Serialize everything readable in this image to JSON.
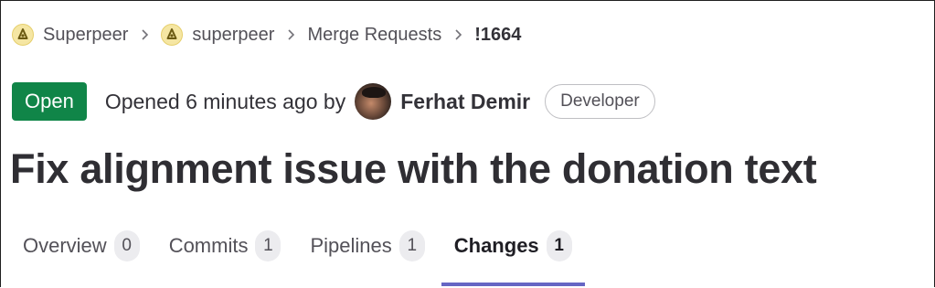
{
  "breadcrumb": {
    "items": [
      {
        "label": "Superpeer",
        "icon": "project-avatar-icon"
      },
      {
        "label": "superpeer",
        "icon": "project-avatar-icon"
      },
      {
        "label": "Merge Requests"
      },
      {
        "label": "!1664"
      }
    ]
  },
  "status": {
    "badge": "Open",
    "badge_color": "#108548",
    "opened_text": "Opened 6 minutes ago by",
    "author": "Ferhat Demir",
    "role": "Developer"
  },
  "title": "Fix alignment issue with the donation text",
  "tabs": [
    {
      "label": "Overview",
      "count": "0",
      "active": false
    },
    {
      "label": "Commits",
      "count": "1",
      "active": false
    },
    {
      "label": "Pipelines",
      "count": "1",
      "active": false
    },
    {
      "label": "Changes",
      "count": "1",
      "active": true
    }
  ],
  "colors": {
    "accent": "#6666c4",
    "text": "#333238"
  }
}
